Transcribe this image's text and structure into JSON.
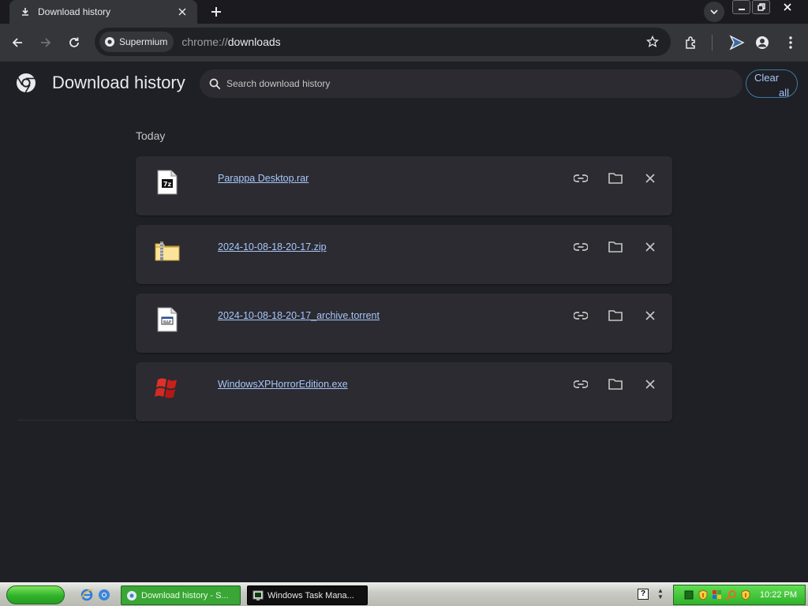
{
  "tab": {
    "title": "Download history",
    "icon": "download-icon"
  },
  "omnibox": {
    "chip_label": "Supermium",
    "url_scheme": "chrome://",
    "url_path": "downloads"
  },
  "header": {
    "title": "Download history",
    "search_placeholder": "Search download history",
    "clear_all_line1": "Clear",
    "clear_all_line2": "all"
  },
  "section": {
    "label": "Today"
  },
  "downloads": [
    {
      "name": "Parappa Desktop.rar",
      "icon": "7z-archive-icon"
    },
    {
      "name": "2024-10-08-18-20-17.zip",
      "icon": "zip-folder-icon"
    },
    {
      "name": "2024-10-08-18-20-17_archive.torrent",
      "icon": "torrent-file-icon"
    },
    {
      "name": "WindowsXPHorrorEdition.exe",
      "icon": "windows-flag-icon"
    }
  ],
  "taskbar": {
    "buttons": [
      {
        "label": "Download history - S...",
        "icon": "chrome-icon"
      },
      {
        "label": "Windows Task Mana...",
        "icon": "task-manager-icon"
      }
    ],
    "help_glyph": "?",
    "clock": "10:22 PM"
  },
  "colors": {
    "background": "#1f1f26",
    "card": "#2b2b31",
    "link": "#a8c7fa",
    "toolbar": "#35363a"
  }
}
